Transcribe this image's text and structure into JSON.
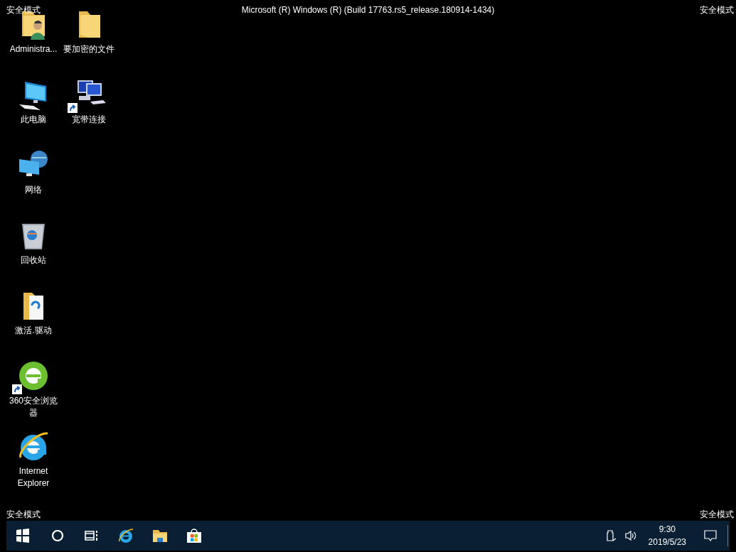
{
  "screen_title": "Microsoft (R) Windows (R) (Build 17763.rs5_release.180914-1434)",
  "corner_labels": [
    "安全模式",
    "安全模式",
    "安全模式",
    "安全模式"
  ],
  "desktop_rows": [
    [
      {
        "label": "Administra...",
        "kind": "user-folder",
        "shortcut": false
      },
      {
        "label": "要加密的文件",
        "kind": "folder",
        "shortcut": false
      }
    ],
    [
      {
        "label": "此电脑",
        "kind": "computer",
        "shortcut": false
      },
      {
        "label": "宽带连接",
        "kind": "network-connection",
        "shortcut": true
      }
    ],
    [
      {
        "label": "网络",
        "kind": "network",
        "shortcut": false
      }
    ],
    [
      {
        "label": "回收站",
        "kind": "recycle-bin",
        "shortcut": false
      }
    ],
    [
      {
        "label": "激活.驱动",
        "kind": "document-folder",
        "shortcut": false
      }
    ],
    [
      {
        "label": "360安全浏览器",
        "kind": "green-browser",
        "shortcut": true
      }
    ],
    [
      {
        "label": "Internet Explorer",
        "kind": "blue-browser",
        "shortcut": false
      }
    ]
  ],
  "taskbar": {
    "buttons": [
      {
        "kind": "start"
      },
      {
        "kind": "search"
      },
      {
        "kind": "task-view"
      },
      {
        "kind": "ie"
      },
      {
        "kind": "explorer"
      },
      {
        "kind": "store"
      }
    ],
    "tray": {
      "time": "9:30",
      "date": "2019/5/23"
    }
  }
}
